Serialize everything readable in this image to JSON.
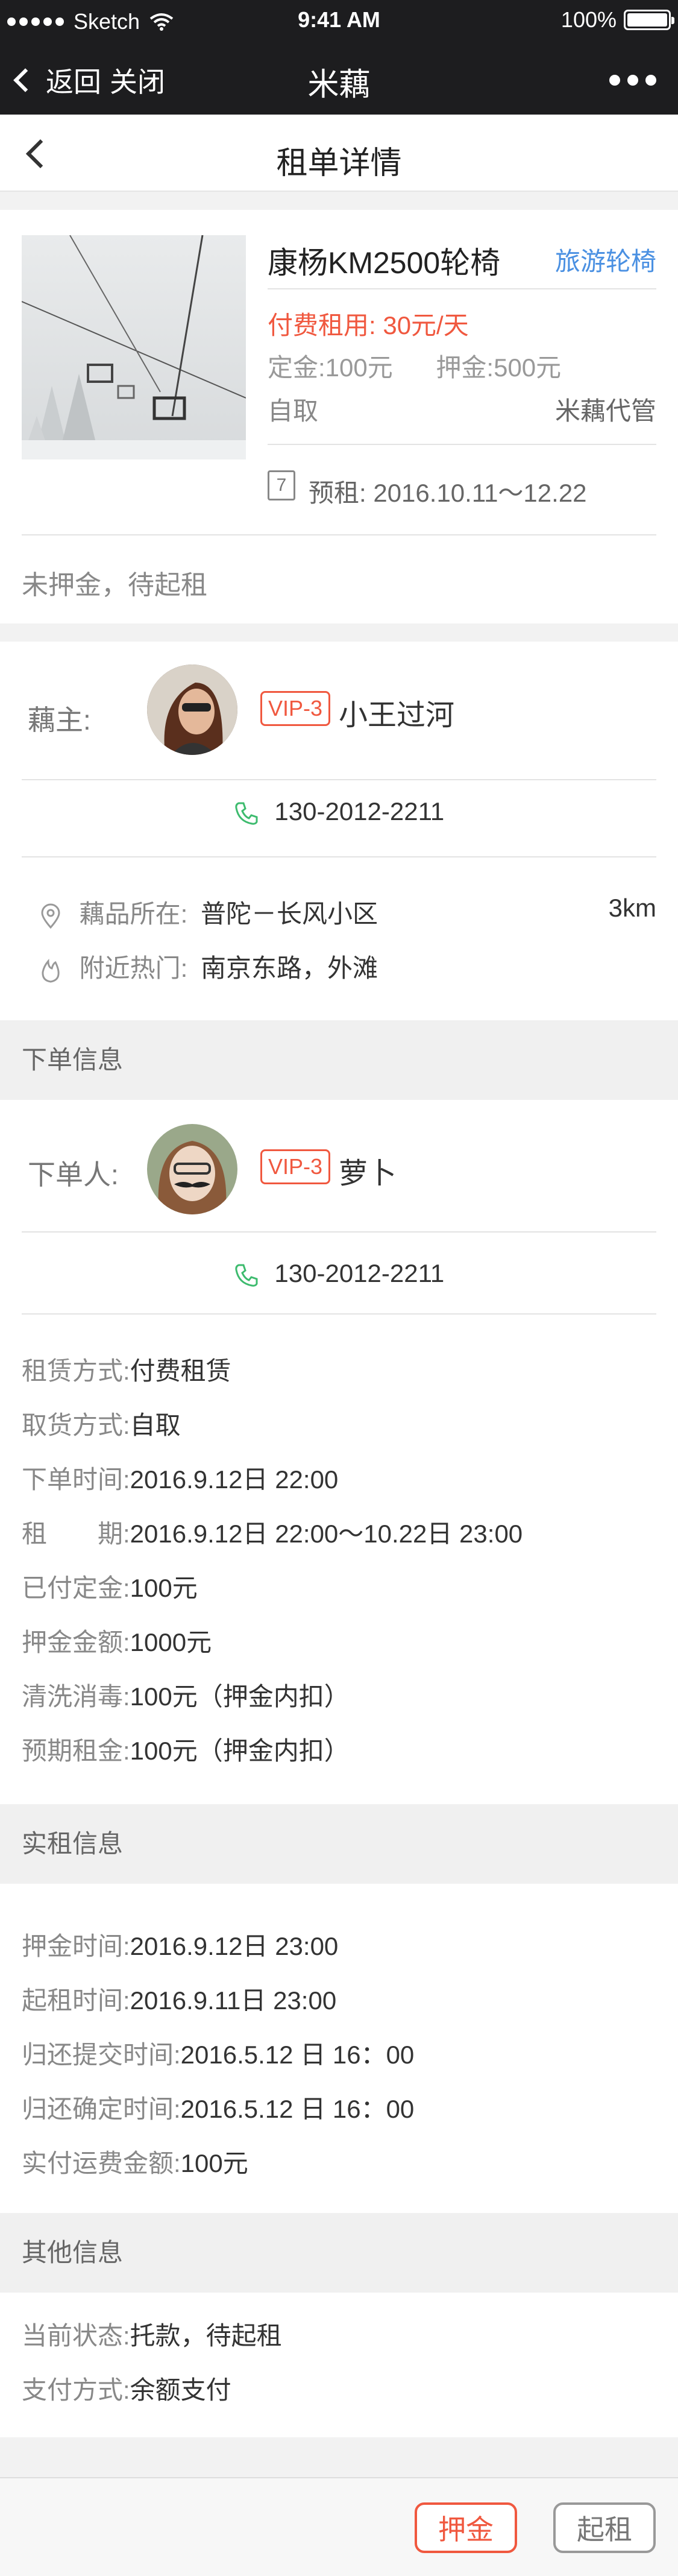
{
  "status_bar": {
    "carrier": "Sketch",
    "time": "9:41 AM",
    "battery": "100%"
  },
  "nav": {
    "back_label": "返回",
    "close_label": "关闭",
    "title": "米藕"
  },
  "subheader": {
    "title": "租单详情"
  },
  "product": {
    "name": "康杨KM2500轮椅",
    "tag": "旅游轮椅",
    "fee_label": "付费租用:",
    "fee_value": "30元/天",
    "deposit_label": "定金:",
    "deposit_value": "100元",
    "guarantee_label": "押金:",
    "guarantee_value": "500元",
    "pickup": "自取",
    "agent": "米藕代管",
    "calendar_day": "7",
    "reserve_label": "预租:",
    "reserve_value": "2016.10.11～12.22",
    "status_note": "未押金，待起租"
  },
  "owner": {
    "label": "藕主:",
    "vip": "VIP-3",
    "name": "小王过河",
    "phone": "130-2012-2211",
    "location_label": "藕品所在:",
    "location_value": "普陀－长风小区",
    "distance": "3km",
    "hot_label": "附近热门:",
    "hot_value": "南京东路，外滩"
  },
  "order_section": {
    "title": "下单信息"
  },
  "orderer": {
    "label": "下单人:",
    "vip": "VIP-3",
    "name": "萝卜",
    "phone": "130-2012-2211"
  },
  "order_details": [
    {
      "k": "租赁方式:",
      "v": "付费租赁"
    },
    {
      "k": "取货方式:",
      "v": "自取"
    },
    {
      "k": "下单时间:",
      "v": "2016.9.12日 22:00"
    },
    {
      "k": "租　　期:",
      "v": "2016.9.12日 22:00～10.22日 23:00"
    },
    {
      "k": "已付定金:",
      "v": "100元"
    },
    {
      "k": "押金金额:",
      "v": "1000元"
    },
    {
      "k": "清洗消毒:",
      "v": "100元（押金内扣）"
    },
    {
      "k": "预期租金:",
      "v": "100元（押金内扣）"
    }
  ],
  "rent_section": {
    "title": "实租信息"
  },
  "rent_details": [
    {
      "k": "押金时间:",
      "v": "2016.9.12日 23:00"
    },
    {
      "k": "起租时间:",
      "v": "2016.9.11日 23:00"
    },
    {
      "k": "归还提交时间:",
      "v": "2016.5.12 日 16：00"
    },
    {
      "k": "归还确定时间:",
      "v": "2016.5.12 日 16：00"
    },
    {
      "k": "实付运费金额:",
      "v": "100元"
    }
  ],
  "other_section": {
    "title": "其他信息"
  },
  "other_details": [
    {
      "k": "当前状态:",
      "v": "托款，待起租"
    },
    {
      "k": "支付方式:",
      "v": "余额支付"
    }
  ],
  "footer": {
    "deposit_button": "押金",
    "start_button": "起租"
  },
  "colors": {
    "accent": "#f0583f",
    "link": "#4a90e2",
    "phone": "#3dbb6e"
  }
}
